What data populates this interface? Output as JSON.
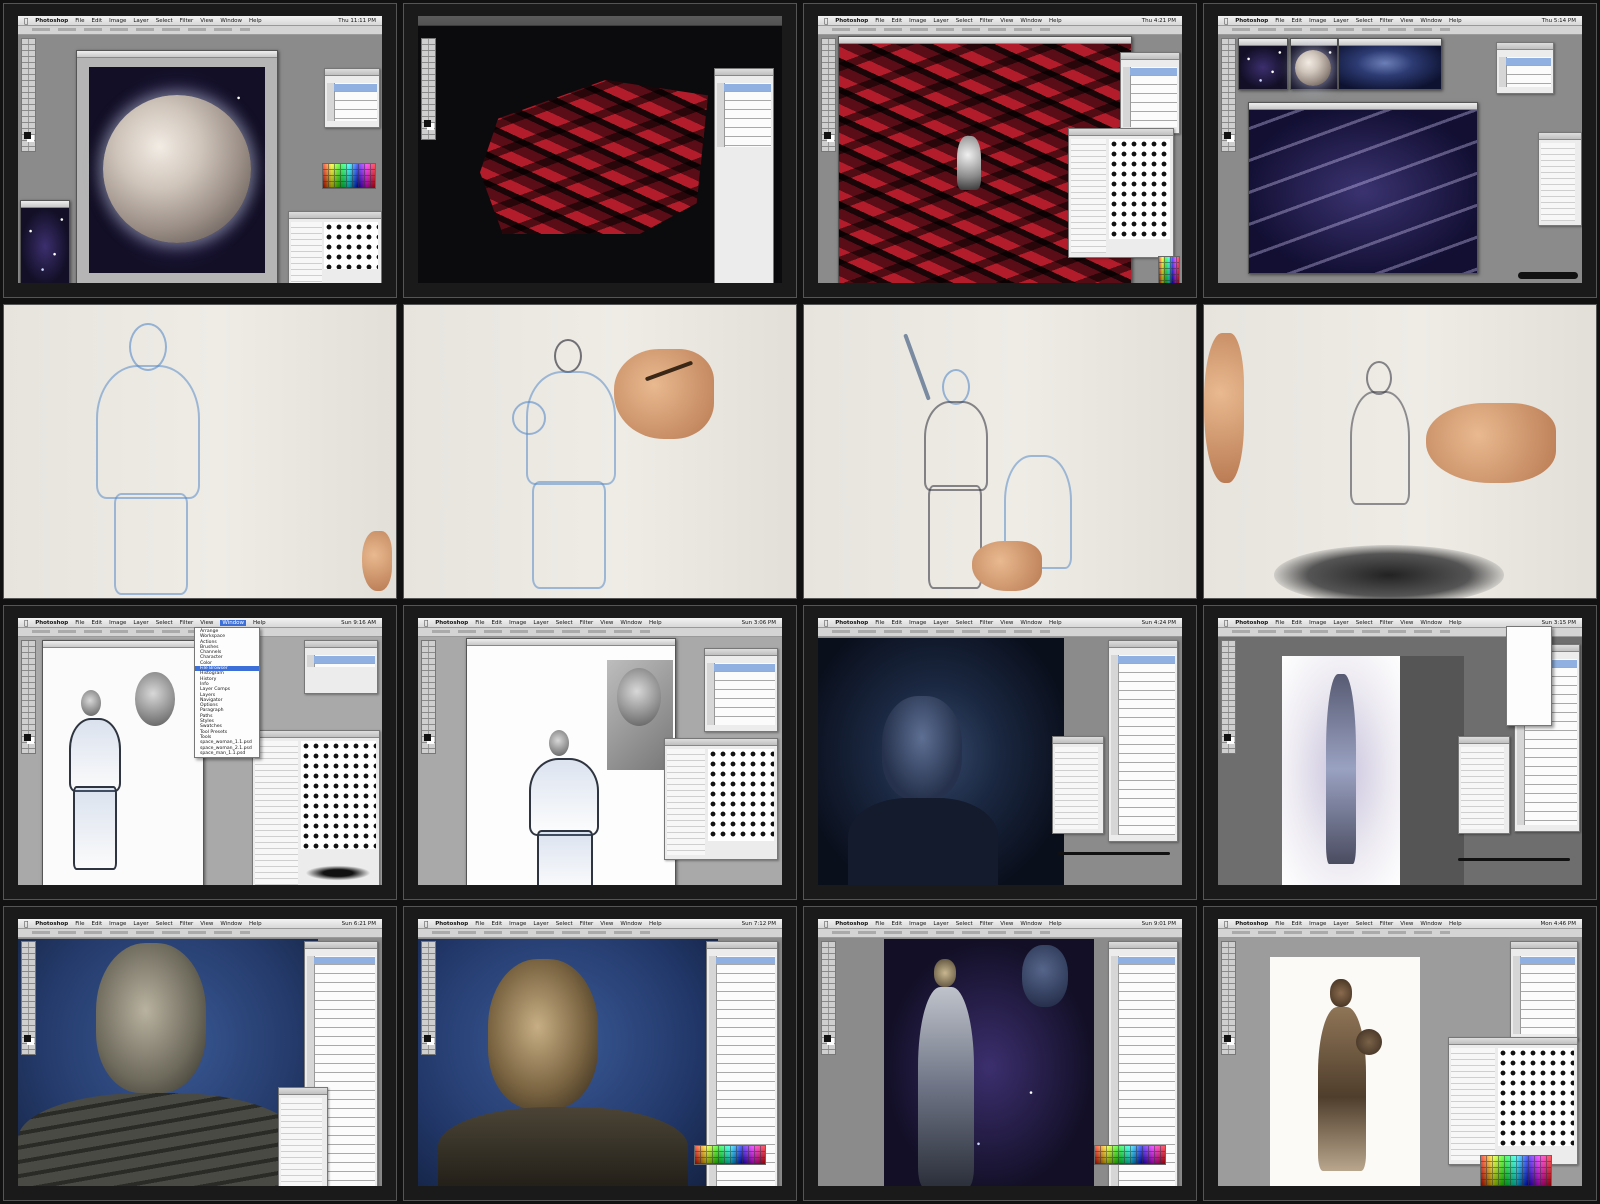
{
  "menu": {
    "app": "Photoshop",
    "items": [
      "File",
      "Edit",
      "Image",
      "Layer",
      "Select",
      "Filter",
      "View",
      "Window",
      "Help"
    ]
  },
  "clocks": {
    "f1": "Thu 11:11 PM",
    "f3": "Thu 4:21 PM",
    "f4": "Thu 5:14 PM",
    "f9": "Sun 9:16 AM",
    "f10": "Sun 3:06 PM",
    "f11": "Sun 4:24 PM",
    "f12": "Sun 3:15 PM",
    "f13": "Sun 6:21 PM",
    "f14": "Sun 7:12 PM",
    "f15": "Sun 9:01 PM",
    "f16": "Mon 4:46 PM"
  },
  "window_menu": {
    "items": [
      "Arrange",
      "Workspace",
      "Actions",
      "Brushes",
      "Channels",
      "Character",
      "Color",
      "File Browser",
      "Histogram",
      "History",
      "Info",
      "Layer Comps",
      "Layers",
      "Navigator",
      "Options",
      "Paragraph",
      "Paths",
      "Styles",
      "Swatches",
      "Tool Presets",
      "Tools",
      "space_woman_1.1.psd",
      "space_woman_2.1.psd",
      "space_man_1.1.psd"
    ]
  },
  "colors": {
    "background": "#111111",
    "ui_gray": "#8b8b8b",
    "panel": "#ececec",
    "selection_blue": "#3d6fd8",
    "sketch_blue": "#5a8cc8",
    "red_rock": "#b31d2b"
  }
}
